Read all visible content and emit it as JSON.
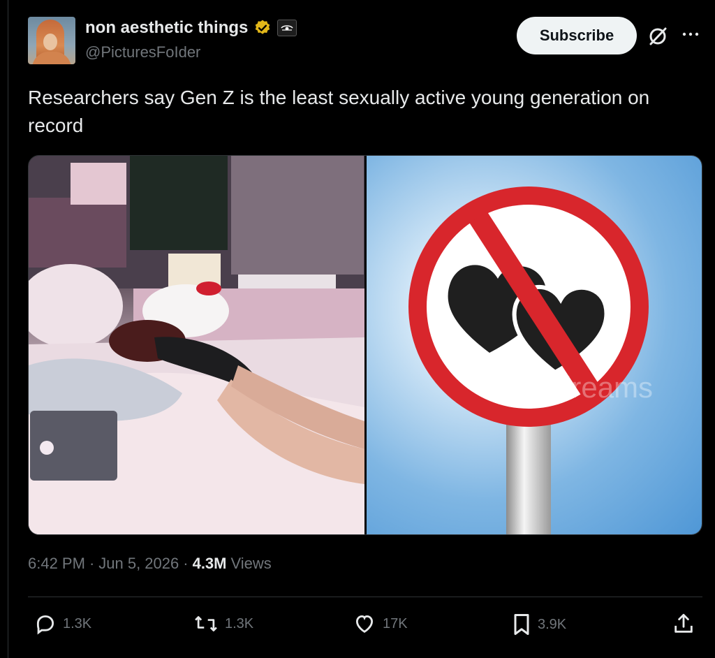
{
  "author": {
    "display_name": "non aesthetic things",
    "handle": "@PicturesFoIder"
  },
  "header": {
    "subscribe_label": "Subscribe"
  },
  "tweet": {
    "text": "Researchers say Gen Z is the least sexually active young generation on record"
  },
  "meta": {
    "time": "6:42 PM",
    "separator": "·",
    "date": "Jun 5, 2026",
    "views": "4.3M",
    "views_label": "Views"
  },
  "actions": {
    "replies": "1.3K",
    "reposts": "1.3K",
    "likes": "17K",
    "bookmarks": "3.9K"
  },
  "media": {
    "watermark": "dreams"
  },
  "colors": {
    "background": "#000000",
    "text": "#e7e9ea",
    "muted": "#71767b",
    "verified": "#e2b719",
    "sign_red": "#d8262c"
  }
}
